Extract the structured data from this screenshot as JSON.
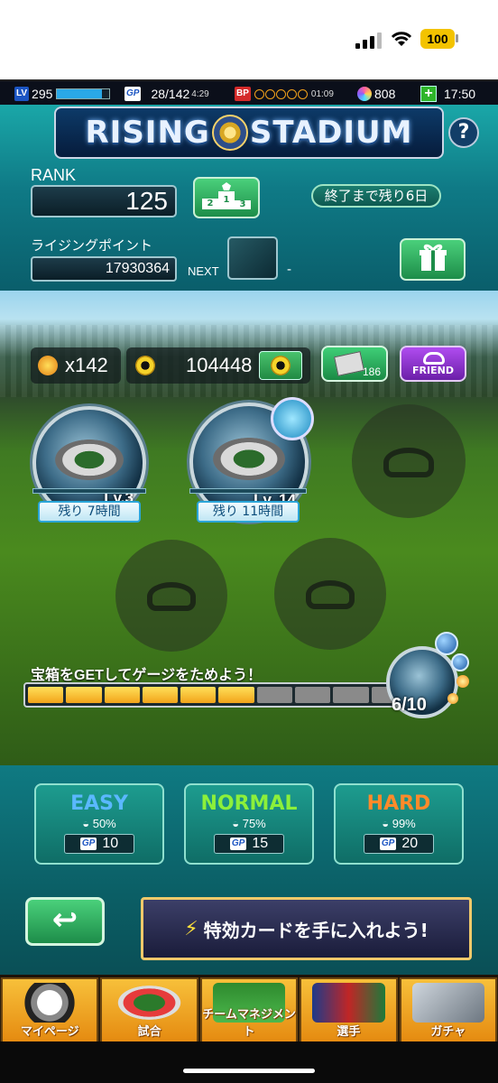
{
  "ios": {
    "time": "17:50",
    "battery": "100"
  },
  "game_bar": {
    "lv_badge": "LV",
    "level": "295",
    "level_progress": 0.85,
    "gp_badge": "GP",
    "gp": "28/142",
    "gp_timer": "4:29",
    "bp_badge": "BP",
    "bp_timer": "01:09",
    "gems": "808",
    "plus": "+",
    "clock": "17:50"
  },
  "header": {
    "title_left": "RISING",
    "title_right": "STADIUM",
    "help": "?",
    "rank_label": "RANK",
    "rank_value": "125",
    "remaining": "終了まで残り6日",
    "rising_points_label": "ライジングポイント",
    "rising_points_value": "17930364",
    "next_label": "NEXT",
    "next_value": "-"
  },
  "counters": {
    "ball_count": "x142",
    "medals": "104448",
    "card_count": "186",
    "friend_label": "FRIEND"
  },
  "stadium_slots": [
    {
      "level": "Lv.3",
      "timer": "残り 7時間",
      "filled": true
    },
    {
      "level": "Lv. 14",
      "timer": "残り 11時間",
      "filled": true
    },
    {
      "filled": false
    },
    {
      "filled": false
    },
    {
      "filled": false
    }
  ],
  "gauge": {
    "text": "宝箱をGETしてゲージをためよう！",
    "filled": 6,
    "total": 10,
    "count_text": "6/10"
  },
  "difficulties": [
    {
      "name": "EASY",
      "pct": "50%",
      "gp": "10",
      "color": "#5ab8ff"
    },
    {
      "name": "NORMAL",
      "pct": "75%",
      "gp": "15",
      "color": "#8cf03a"
    },
    {
      "name": "HARD",
      "pct": "99%",
      "gp": "20",
      "color": "#ff8a2a"
    }
  ],
  "promo": "特効カードを手に入れよう!",
  "back_icon": "↩",
  "nav": [
    {
      "label": "マイページ",
      "icon": "mypage-icon"
    },
    {
      "label": "試合",
      "icon": "stadium-icon"
    },
    {
      "label": "チームマネジメント",
      "icon": "formation-icon"
    },
    {
      "label": "選手",
      "icon": "players-icon"
    },
    {
      "label": "ガチャ",
      "icon": "gacha-icon"
    }
  ]
}
